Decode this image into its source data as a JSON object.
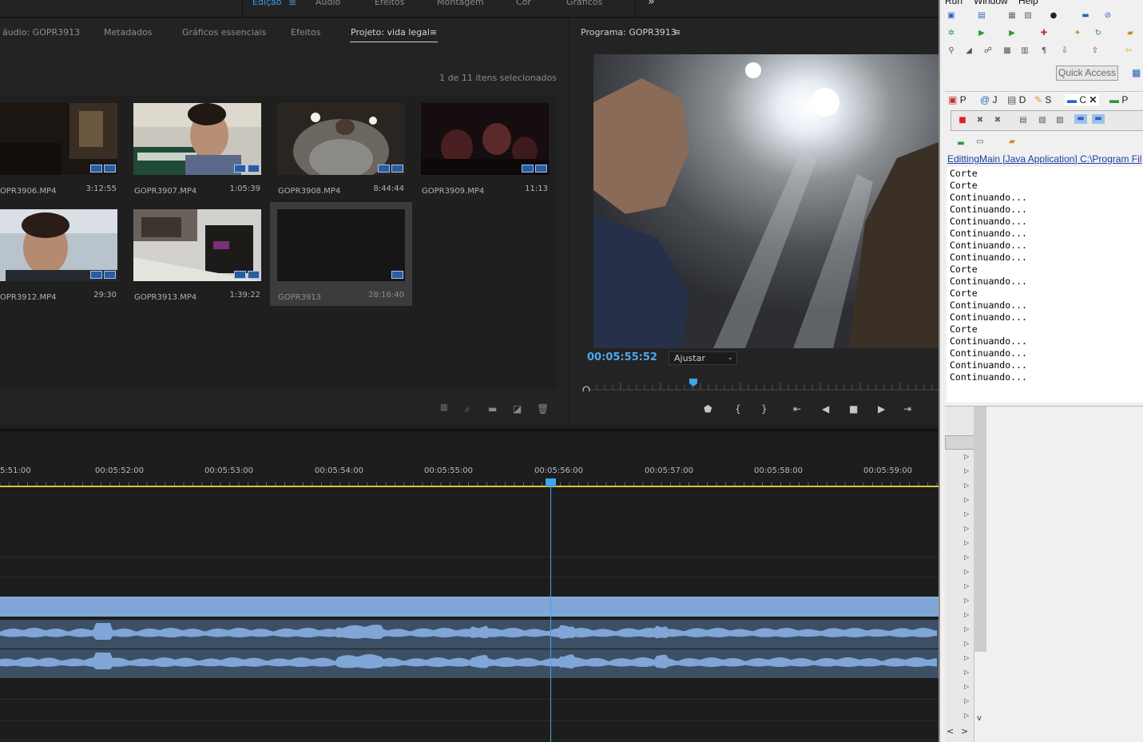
{
  "workspace": {
    "tabs": [
      "Edição",
      "Áudio",
      "Efeitos",
      "Montagem",
      "Cor",
      "Gráficos"
    ],
    "more": "»",
    "menu_icon": "hamburger-icon"
  },
  "project_panel": {
    "tabs": [
      "áudio: GOPR3913",
      "Metadados",
      "Gráficos essenciais",
      "Efeitos",
      "Projeto: vida legal"
    ],
    "menu_glyph": "≡",
    "selection_status": "1 de 11 itens selecionados",
    "clips": [
      {
        "name": "OPR3906.MP4",
        "duration": "3:12:55"
      },
      {
        "name": "GOPR3907.MP4",
        "duration": "1:05:39"
      },
      {
        "name": "GOPR3908.MP4",
        "duration": "8:44:44"
      },
      {
        "name": "GOPR3909.MP4",
        "duration": "11:13"
      },
      {
        "name": "OPR3912.MP4",
        "duration": "29:30"
      },
      {
        "name": "GOPR3913.MP4",
        "duration": "1:39:22"
      },
      {
        "name": "GOPR3913",
        "duration": "28:16:40"
      }
    ],
    "tools": [
      "freeform-view-icon",
      "search-icon",
      "new-bin-icon",
      "new-item-icon",
      "trash-icon"
    ]
  },
  "program_monitor": {
    "title": "Programa: GOPR3913",
    "menu_glyph": "≡",
    "timecode": "00:05:55:52",
    "fit": "Ajustar",
    "controls": [
      "add-marker-icon",
      "mark-in-icon",
      "mark-out-icon",
      "go-to-in-icon",
      "step-back-icon",
      "stop-icon",
      "step-forward-icon",
      "go-to-out-icon"
    ]
  },
  "timeline": {
    "timecodes": [
      "5:51:00",
      "00:05:52:00",
      "00:05:53:00",
      "00:05:54:00",
      "00:05:55:00",
      "00:05:56:00",
      "00:05:57:00",
      "00:05:58:00",
      "00:05:59:00"
    ],
    "playhead_time": "00:05:56:00"
  },
  "eclipse": {
    "menus": [
      "Run",
      "Window",
      "Help"
    ],
    "quick_access": "Quick Access",
    "view_tabs": [
      "P",
      "J",
      "D",
      "S",
      "C",
      "P"
    ],
    "console_title": "EdittingMain [Java Application] C:\\Program Fil",
    "console_lines": [
      "Corte",
      "Corte",
      "Continuando...",
      "Continuando...",
      "Continuando...",
      "Continuando...",
      "Continuando...",
      "Continuando...",
      "Corte",
      "Continuando...",
      "Corte",
      "Continuando...",
      "Continuando...",
      "Corte",
      "Continuando...",
      "Continuando...",
      "Continuando...",
      "Continuando..."
    ],
    "colors": {
      "link": "#1a3fa8",
      "accent": "#3f9be6"
    }
  }
}
